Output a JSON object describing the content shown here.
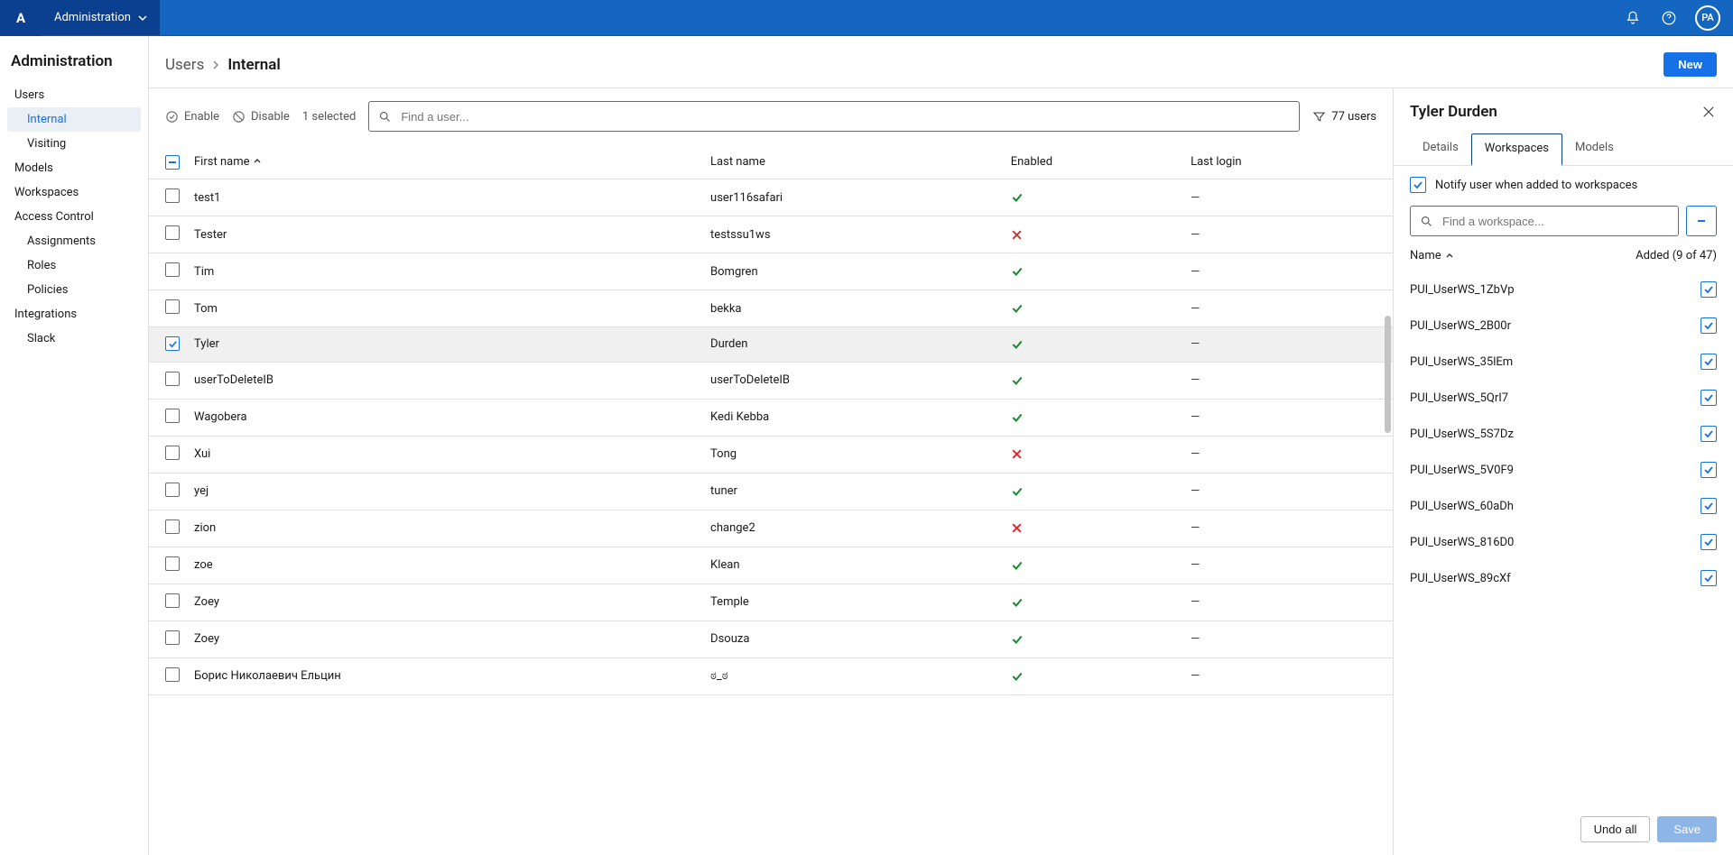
{
  "topbar": {
    "logo_text": "A",
    "app_menu_label": "Administration",
    "avatar_text": "PA"
  },
  "sidebar": {
    "title": "Administration",
    "groups": [
      {
        "label": "Users",
        "children": [
          {
            "label": "Internal",
            "selected": true
          },
          {
            "label": "Visiting"
          }
        ]
      },
      {
        "label": "Models"
      },
      {
        "label": "Workspaces"
      },
      {
        "label": "Access Control",
        "children": [
          {
            "label": "Assignments"
          },
          {
            "label": "Roles"
          },
          {
            "label": "Policies"
          }
        ]
      },
      {
        "label": "Integrations",
        "children": [
          {
            "label": "Slack"
          }
        ]
      }
    ]
  },
  "breadcrumb": {
    "parent": "Users",
    "current": "Internal",
    "new_button": "New"
  },
  "toolbar": {
    "enable_label": "Enable",
    "disable_label": "Disable",
    "selected_text": "1 selected",
    "search_placeholder": "Find a user...",
    "filter_count": "77 users"
  },
  "columns": {
    "first_name": "First name",
    "last_name": "Last name",
    "enabled": "Enabled",
    "last_login": "Last login"
  },
  "rows": [
    {
      "first": "test1",
      "last": "user116safari",
      "enabled": true,
      "login": "—"
    },
    {
      "first": "Tester",
      "last": "testssu1ws",
      "enabled": false,
      "login": "—"
    },
    {
      "first": "Tim",
      "last": "Bomgren",
      "enabled": true,
      "login": "—"
    },
    {
      "first": "Tom",
      "last": "bekka",
      "enabled": true,
      "login": "—"
    },
    {
      "first": "Tyler",
      "last": "Durden",
      "enabled": true,
      "login": "—",
      "selected": true
    },
    {
      "first": "userToDeleteIB",
      "last": "userToDeleteIB",
      "enabled": true,
      "login": "—"
    },
    {
      "first": "Wagobera",
      "last": "Kedi Kebba",
      "enabled": true,
      "login": "—"
    },
    {
      "first": "Xui",
      "last": "Tong",
      "enabled": false,
      "login": "—"
    },
    {
      "first": "yej",
      "last": "tuner",
      "enabled": true,
      "login": "—"
    },
    {
      "first": "zion",
      "last": "change2",
      "enabled": false,
      "login": "—"
    },
    {
      "first": "zoe",
      "last": "Klean",
      "enabled": true,
      "login": "—"
    },
    {
      "first": "Zoey",
      "last": "Temple",
      "enabled": true,
      "login": "—"
    },
    {
      "first": "Zoey",
      "last": "Dsouza",
      "enabled": true,
      "login": "—"
    },
    {
      "first": "Борис Николаевич Ельцин",
      "last": "ಠ_ಠ",
      "enabled": true,
      "login": "—"
    }
  ],
  "detail": {
    "title": "Tyler Durden",
    "tabs": {
      "details": "Details",
      "workspaces": "Workspaces",
      "models": "Models"
    },
    "notify_label": "Notify user when added to workspaces",
    "search_placeholder": "Find a workspace...",
    "ws_name_header": "Name",
    "ws_added_header": "Added (9 of 47)",
    "undo_label": "Undo all",
    "save_label": "Save",
    "workspaces": [
      {
        "name": "PUI_UserWS_1ZbVp",
        "added": true
      },
      {
        "name": "PUI_UserWS_2B00r",
        "added": true
      },
      {
        "name": "PUI_UserWS_35lEm",
        "added": true
      },
      {
        "name": "PUI_UserWS_5QrI7",
        "added": true
      },
      {
        "name": "PUI_UserWS_5S7Dz",
        "added": true
      },
      {
        "name": "PUI_UserWS_5V0F9",
        "added": true
      },
      {
        "name": "PUI_UserWS_60aDh",
        "added": true
      },
      {
        "name": "PUI_UserWS_816D0",
        "added": true
      },
      {
        "name": "PUI_UserWS_89cXf",
        "added": true
      }
    ]
  }
}
